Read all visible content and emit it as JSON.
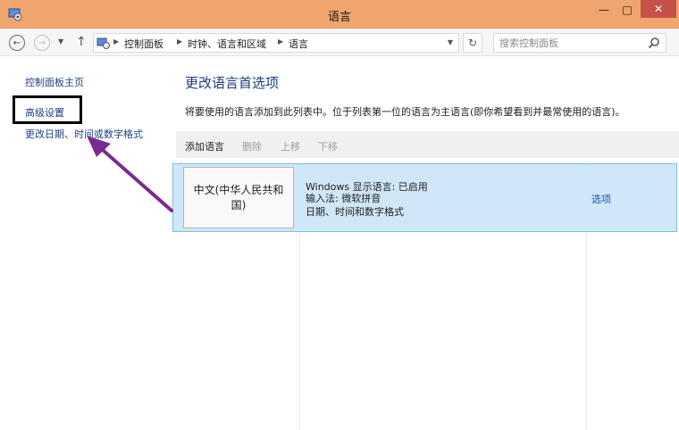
{
  "window": {
    "title": "语言"
  },
  "address_bar": {
    "crumbs": [
      "控制面板",
      "时钟、语言和区域",
      "语言"
    ],
    "search_placeholder": "搜索控制面板"
  },
  "sidebar": {
    "home": "控制面板主页",
    "advanced": "高级设置",
    "date_format": "更改日期、时间或数字格式"
  },
  "main": {
    "heading": "更改语言首选项",
    "description": "将要使用的语言添加到此列表中。位于列表第一位的语言为主语言(即你希望看到并最常使用的语言)。",
    "toolbar": {
      "add": "添加语言",
      "remove": "删除",
      "move_up": "上移",
      "move_down": "下移"
    },
    "languages": [
      {
        "name": "中文(中华人民共和国)",
        "details": [
          "Windows 显示语言: 已启用",
          "输入法: 微软拼音",
          "日期、时间和数字格式"
        ],
        "options": "选项"
      }
    ]
  },
  "colors": {
    "titlebar": "#f0a46e",
    "close_button": "#c7504a",
    "selected_row": "#cfe7f6",
    "link": "#1e3f86",
    "annotation_arrow": "#7b2a90",
    "highlight_box": "#000000"
  },
  "icons": [
    "control-panel-icon",
    "back-icon",
    "forward-icon",
    "up-icon",
    "refresh-icon",
    "search-icon",
    "minimize-icon",
    "maximize-icon",
    "close-icon"
  ]
}
